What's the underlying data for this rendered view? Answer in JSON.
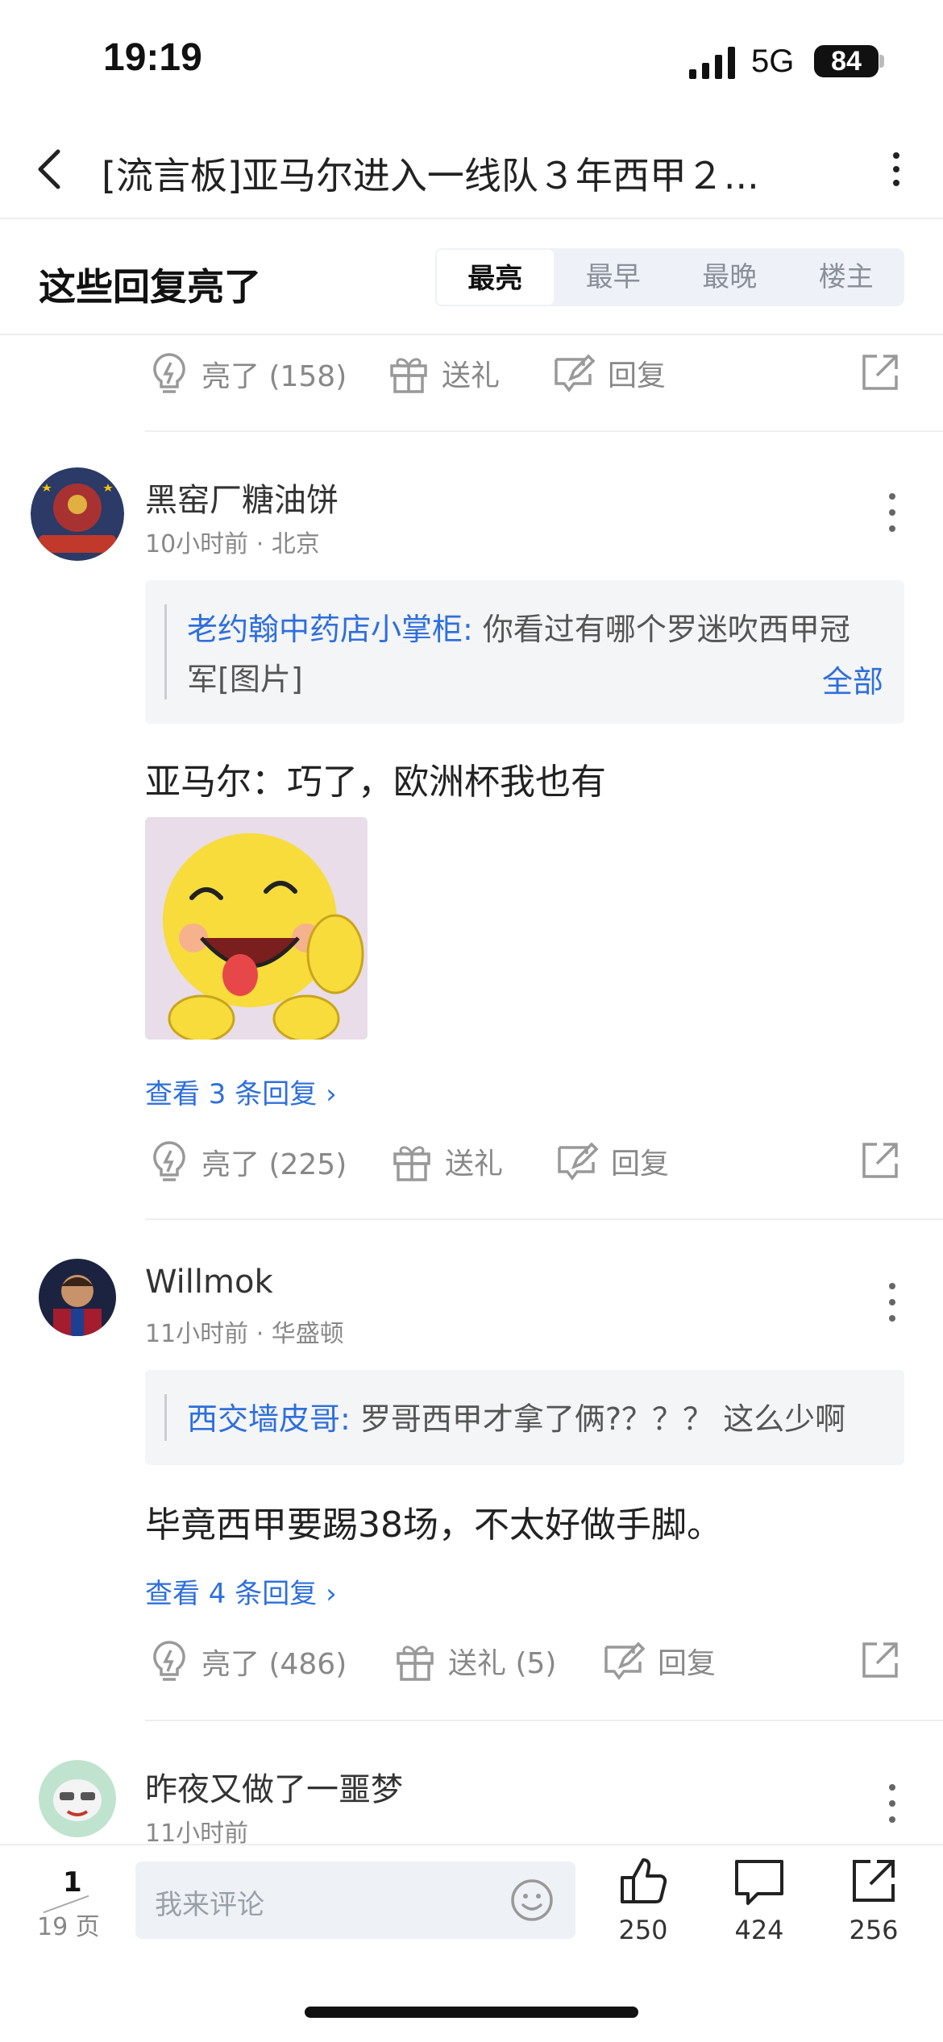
{
  "status_bar": {
    "time": "19:19",
    "network": "5G",
    "battery": "84"
  },
  "header": {
    "title": "[流言板]亚马尔进入一线队３年西甲２..."
  },
  "filter": {
    "section_title": "这些回复亮了",
    "tabs": [
      "最亮",
      "最早",
      "最晚",
      "楼主"
    ],
    "active_tab": "最亮"
  },
  "top_actions": {
    "light": "亮了 (158)",
    "gift": "送礼",
    "reply": "回复"
  },
  "comments": [
    {
      "username": "黑窑厂糖油饼",
      "time": "10小时前",
      "location": "北京",
      "meta": "10小时前 · 北京",
      "quote_user": "老约翰中药店小掌柜:",
      "quote_text": " 你看过有哪个罗迷吹西甲冠军[图片]",
      "quote_all": "全部",
      "text": "亚马尔：巧了，欧洲杯我也有",
      "view_replies": "查看 3 条回复",
      "actions": {
        "light": "亮了 (225)",
        "gift": "送礼",
        "reply": "回复"
      }
    },
    {
      "username": "Willmok",
      "time": "11小时前",
      "location": "华盛顿",
      "meta": "11小时前 · 华盛顿",
      "quote_user": "西交墙皮哥:",
      "quote_text": " 罗哥西甲才拿了俩?？？？ 这么少啊",
      "text": "毕竟西甲要踢38场，不太好做手脚。",
      "view_replies": "查看 4 条回复",
      "actions": {
        "light": "亮了 (486)",
        "gift": "送礼 (5)",
        "reply": "回复"
      }
    },
    {
      "username": "昨夜又做了一噩梦",
      "time": "11小时前",
      "meta": "11小时前"
    }
  ],
  "bottom_bar": {
    "page": "1",
    "total_pages": "19 页",
    "comment_placeholder": "我来评论",
    "likes": "250",
    "comments": "424",
    "shares": "256"
  },
  "colors": {
    "link": "#2f6fdc",
    "muted": "#888888",
    "quote_bg": "#f4f5f7",
    "tabs_bg": "#eef2f8"
  }
}
